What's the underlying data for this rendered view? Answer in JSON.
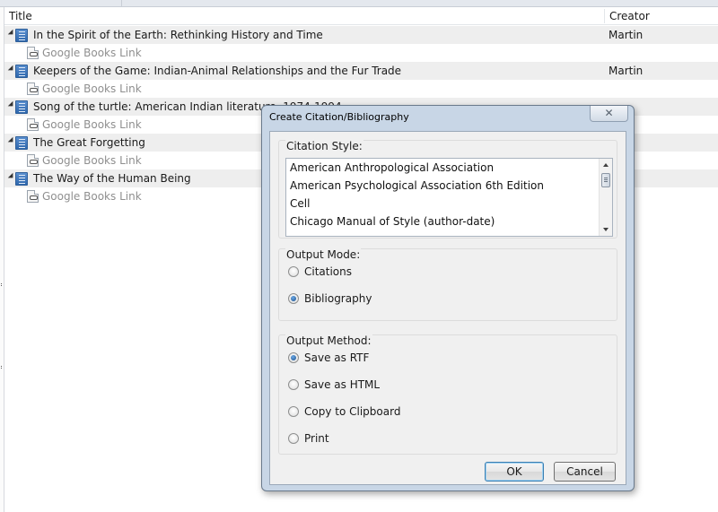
{
  "library": {
    "columns": {
      "title": "Title",
      "creator": "Creator"
    },
    "rows": [
      {
        "title": "In the Spirit of the Earth: Rethinking History and Time",
        "creator": "Martin",
        "link": "Google Books Link"
      },
      {
        "title": "Keepers of the Game: Indian-Animal Relationships and the Fur Trade",
        "creator": "Martin",
        "link": "Google Books Link"
      },
      {
        "title": "Song of the turtle: American Indian literature, 1974-1994",
        "creator": "",
        "link": "Google Books Link"
      },
      {
        "title": "The Great Forgetting",
        "creator": "",
        "link": "Google Books Link"
      },
      {
        "title": "The Way of the Human Being",
        "creator": "",
        "link": "Google Books Link"
      }
    ]
  },
  "dialog": {
    "title": "Create Citation/Bibliography",
    "close_symbol": "✕",
    "citation_style": {
      "label": "Citation Style:",
      "options": [
        "American Anthropological Association",
        "American Psychological Association 6th Edition",
        "Cell",
        "Chicago Manual of Style (author-date)"
      ]
    },
    "output_mode": {
      "label": "Output Mode:",
      "options": [
        "Citations",
        "Bibliography"
      ],
      "selected": "Bibliography"
    },
    "output_method": {
      "label": "Output Method:",
      "options": [
        "Save as RTF",
        "Save as HTML",
        "Copy to Clipboard",
        "Print"
      ],
      "selected": "Save as RTF"
    },
    "buttons": {
      "ok": "OK",
      "cancel": "Cancel"
    }
  }
}
